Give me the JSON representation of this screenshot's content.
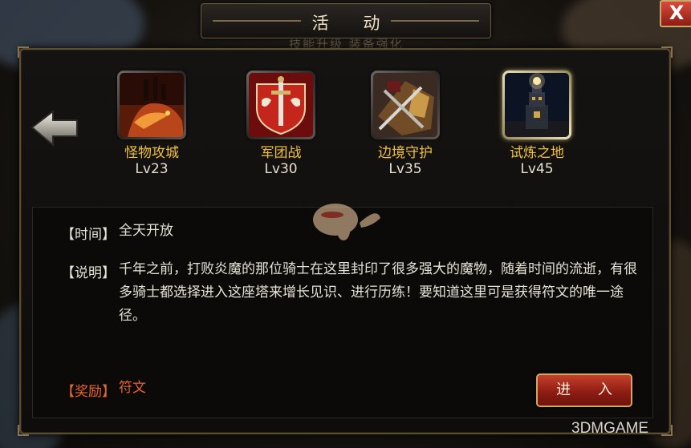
{
  "window": {
    "title": "活 动",
    "close_label": "X"
  },
  "background_tabs": "技能升级  装备强化",
  "activities": [
    {
      "name": "怪物攻城",
      "level": "Lv23",
      "icon": "dragon-castle-icon",
      "selected": false
    },
    {
      "name": "军团战",
      "level": "Lv30",
      "icon": "sword-shield-icon",
      "selected": false
    },
    {
      "name": "边境守护",
      "level": "Lv35",
      "icon": "crossed-swords-icon",
      "selected": false
    },
    {
      "name": "试炼之地",
      "level": "Lv45",
      "icon": "tower-icon",
      "selected": true
    }
  ],
  "details": {
    "time_label": "【时间】",
    "time_value": "全天开放",
    "desc_label": "【说明】",
    "desc_value": "千年之前，打败炎魔的那位骑士在这里封印了很多强大的魔物，随着时间的流逝，有很多骑士都选择进入这座塔来增长见识、进行历练！要知道这里可是获得符文的唯一途径。",
    "reward_label": "【奖励】",
    "reward_value": "符文"
  },
  "enter_button": "进 入",
  "watermark_logo": "3DMGAME",
  "colors": {
    "accent_gold": "#f0c23a",
    "reward_orange": "#e8642a",
    "button_red": "#c5402b"
  }
}
